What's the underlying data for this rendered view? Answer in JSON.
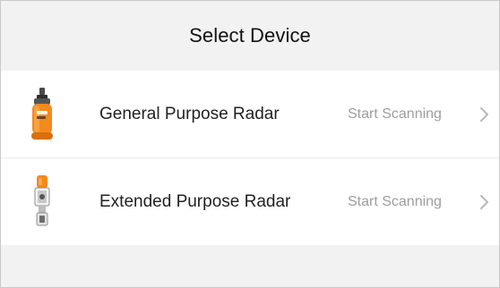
{
  "header": {
    "title": "Select Device"
  },
  "devices": [
    {
      "name": "General Purpose Radar",
      "action_label": "Start Scanning",
      "icon": "orange-radar-sensor-icon"
    },
    {
      "name": "Extended Purpose Radar",
      "action_label": "Start Scanning",
      "icon": "extended-radar-sensor-icon"
    }
  ],
  "colors": {
    "background": "#f2f2f2",
    "row_background": "#ffffff",
    "text_primary": "#222222",
    "text_secondary": "#9e9e9e",
    "accent_orange": "#f28a1d"
  },
  "icons": {
    "chevron": "chevron-right-icon"
  }
}
